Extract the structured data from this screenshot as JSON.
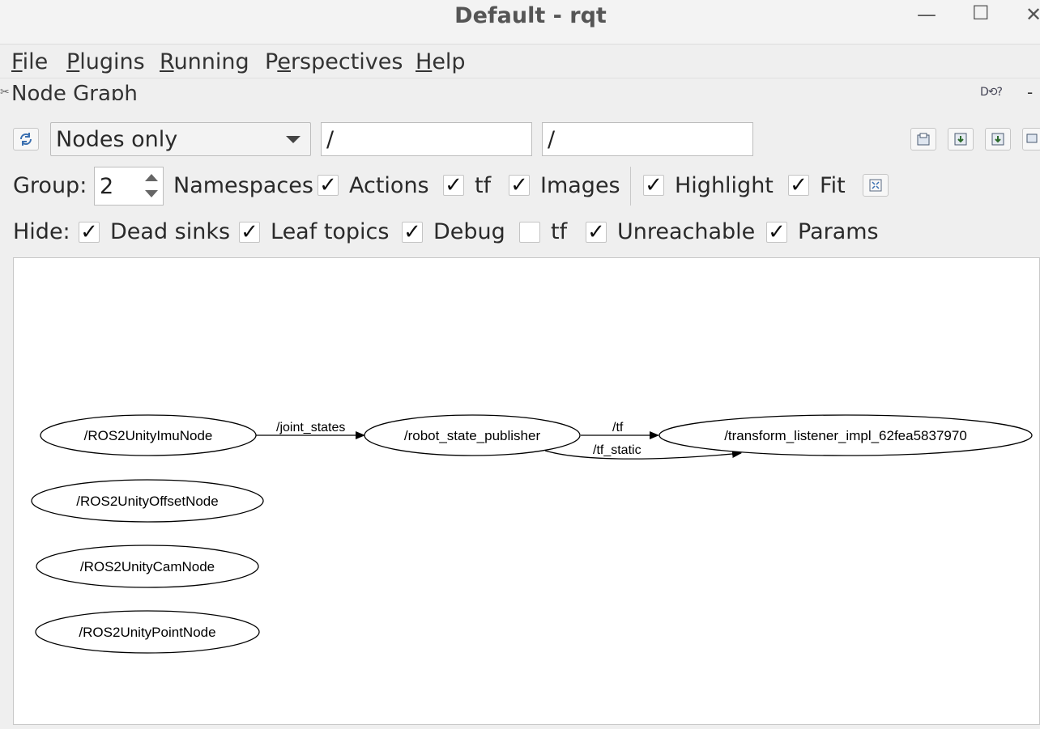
{
  "window": {
    "title": "Default - rqt",
    "minimize_glyph": "—",
    "maximize_glyph": "☐",
    "close_glyph": "✕"
  },
  "menu": [
    {
      "label": "File",
      "mnemonic": "F"
    },
    {
      "label": "Plugins",
      "mnemonic": "P"
    },
    {
      "label": "Running",
      "mnemonic": "R"
    },
    {
      "label": "Perspectives",
      "mnemonic": "e"
    },
    {
      "label": "Help",
      "mnemonic": "H"
    }
  ],
  "dock": {
    "title": "Node Graph",
    "icons": [
      "help-icon",
      "reload-icon",
      "dock-icon"
    ],
    "right_glyphs": "D⟲?",
    "close_glyph": "-"
  },
  "toolbar": {
    "refresh_icon": "refresh-icon",
    "graph_type": "Nodes only",
    "node_filter": "/",
    "topic_filter": "/",
    "right_buttons": [
      "load-dot-icon",
      "save-dot-icon",
      "save-svg-icon",
      "save-image-icon"
    ]
  },
  "group": {
    "label": "Group:",
    "value": "2",
    "options": [
      {
        "label": "Namespaces",
        "checked": true
      },
      {
        "label": "Actions",
        "checked": true
      },
      {
        "label": "tf",
        "checked": true
      },
      {
        "label": "Images",
        "checked": false
      }
    ],
    "highlight": {
      "label": "Highlight",
      "checked": true
    },
    "fit": {
      "label": "Fit",
      "checked": true
    },
    "fit_icon": "fit-in-view-icon"
  },
  "hide": {
    "label": "Hide:",
    "options": [
      {
        "label": "Dead sinks",
        "checked": true
      },
      {
        "label": "Leaf topics",
        "checked": true
      },
      {
        "label": "Debug",
        "checked": true
      },
      {
        "label": "tf",
        "checked": false
      },
      {
        "label": "Unreachable",
        "checked": true
      },
      {
        "label": "Params",
        "checked": true
      }
    ]
  },
  "graph": {
    "nodes": [
      {
        "id": "imu",
        "label": "/ROS2UnityImuNode"
      },
      {
        "id": "rsp",
        "label": "/robot_state_publisher"
      },
      {
        "id": "tl",
        "label": "/transform_listener_impl_62fea5837970"
      },
      {
        "id": "offset",
        "label": "/ROS2UnityOffsetNode"
      },
      {
        "id": "cam",
        "label": "/ROS2UnityCamNode"
      },
      {
        "id": "point",
        "label": "/ROS2UnityPointNode"
      }
    ],
    "edges": [
      {
        "from": "imu",
        "to": "rsp",
        "label": "/joint_states"
      },
      {
        "from": "rsp",
        "to": "tl",
        "label": "/tf"
      },
      {
        "from": "rsp",
        "to": "tl",
        "label": "/tf_static"
      }
    ]
  }
}
